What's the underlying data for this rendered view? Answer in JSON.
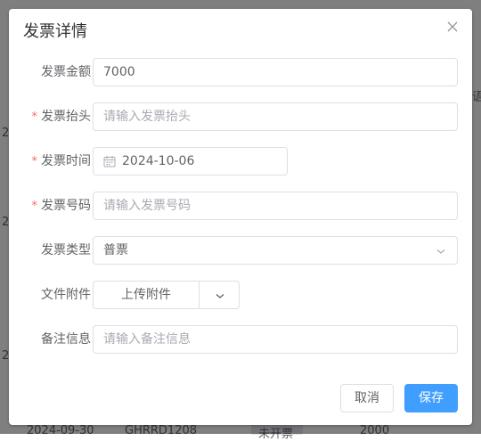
{
  "background": {
    "cells": {
      "peek_right_1": "语",
      "peek_left_1": "2",
      "peek_left_2": "2",
      "peek_left_3": "2",
      "last_row_date": "2024-09-30",
      "last_row_code": "GHRRD1208",
      "last_row_status": "未开票",
      "last_row_amount": "2000"
    }
  },
  "dialog": {
    "title": "发票详情",
    "close_icon": "close-icon",
    "fields": {
      "amount": {
        "label": "发票金额",
        "value": "7000"
      },
      "header": {
        "label": "发票抬头",
        "placeholder": "请输入发票抬头"
      },
      "time": {
        "label": "发票时间",
        "value": "2024-10-06"
      },
      "number": {
        "label": "发票号码",
        "placeholder": "请输入发票号码"
      },
      "type": {
        "label": "发票类型",
        "value": "普票"
      },
      "attachment": {
        "label": "文件附件",
        "button": "上传附件"
      },
      "remark": {
        "label": "备注信息",
        "placeholder": "请输入备注信息"
      }
    },
    "required_mark": "*",
    "buttons": {
      "cancel": "取消",
      "save": "保存"
    }
  },
  "colors": {
    "primary": "#409eff",
    "required": "#f56c6c",
    "border": "#dcdfe6"
  }
}
